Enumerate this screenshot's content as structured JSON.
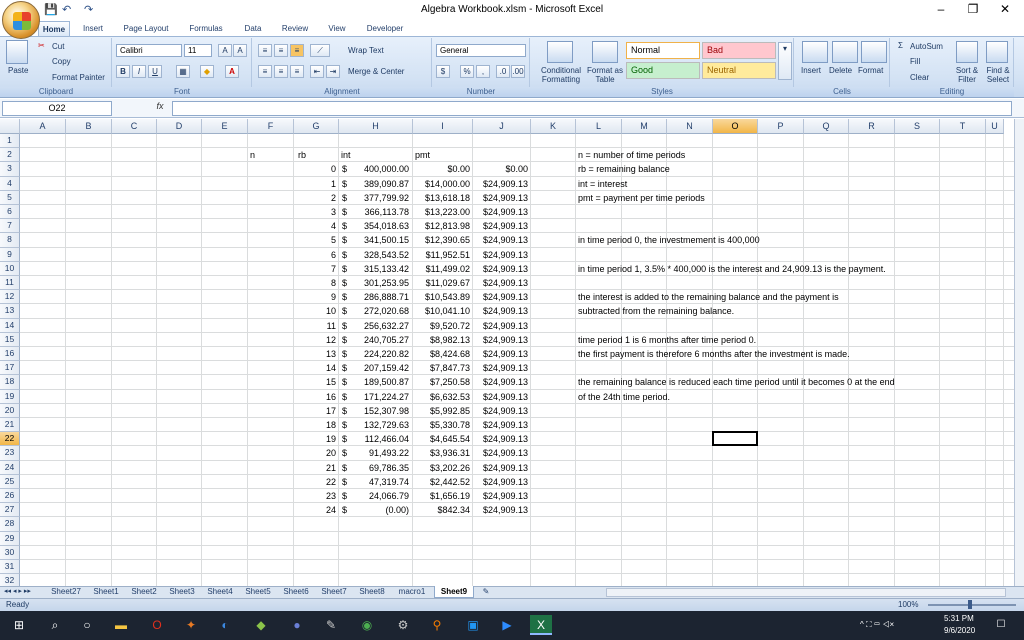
{
  "window": {
    "title": "Algebra Workbook.xlsm - Microsoft Excel",
    "controls": [
      "–",
      "❐",
      "✕"
    ]
  },
  "qat": {
    "save": "💾",
    "undo": "↶",
    "redo": "↷"
  },
  "tabs": [
    "Home",
    "Insert",
    "Page Layout",
    "Formulas",
    "Data",
    "Review",
    "View",
    "Developer"
  ],
  "ribbon": {
    "clipboard": {
      "paste": "Paste",
      "cut": "Cut",
      "copy": "Copy",
      "format_painter": "Format Painter",
      "label": "Clipboard"
    },
    "font": {
      "name": "Calibri",
      "size": "11",
      "bold": "B",
      "italic": "I",
      "underline": "U",
      "label": "Font"
    },
    "alignment": {
      "wrap": "Wrap Text",
      "merge": "Merge & Center",
      "label": "Alignment"
    },
    "number": {
      "format": "General",
      "currency": "$",
      "percent": "%",
      "comma": ",",
      "label": "Number"
    },
    "styles": {
      "cond": "Conditional Formatting",
      "table": "Format as Table",
      "normal": "Normal",
      "bad": "Bad",
      "good": "Good",
      "neutral": "Neutral",
      "label": "Styles"
    },
    "cells": {
      "insert": "Insert",
      "delete": "Delete",
      "format": "Format",
      "label": "Cells"
    },
    "editing": {
      "autosum": "AutoSum",
      "fill": "Fill",
      "clear": "Clear",
      "sort": "Sort & Filter",
      "find": "Find & Select",
      "label": "Editing"
    }
  },
  "formula_bar": {
    "name_box": "O22",
    "fx": "fx",
    "value": ""
  },
  "columns": [
    "A",
    "B",
    "C",
    "D",
    "E",
    "F",
    "G",
    "H",
    "I",
    "J",
    "K",
    "L",
    "M",
    "N",
    "O",
    "P",
    "Q",
    "R",
    "S",
    "T",
    "U"
  ],
  "selected_column": "O",
  "selected_row": 22,
  "rows": [
    "1",
    "2",
    "3",
    "4",
    "5",
    "6",
    "7",
    "8",
    "9",
    "10",
    "11",
    "12",
    "13",
    "14",
    "15",
    "16",
    "17",
    "18",
    "19",
    "20",
    "21",
    "22",
    "23",
    "24",
    "25",
    "26",
    "27",
    "28",
    "29",
    "30",
    "31",
    "32"
  ],
  "headers": {
    "n": "n",
    "rb": "rb",
    "int": "int",
    "pmt": "pmt"
  },
  "table": [
    {
      "n": "0",
      "rb": "400,000.00",
      "int": "$0.00",
      "pmt": "$0.00"
    },
    {
      "n": "1",
      "rb": "389,090.87",
      "int": "$14,000.00",
      "pmt": "$24,909.13"
    },
    {
      "n": "2",
      "rb": "377,799.92",
      "int": "$13,618.18",
      "pmt": "$24,909.13"
    },
    {
      "n": "3",
      "rb": "366,113.78",
      "int": "$13,223.00",
      "pmt": "$24,909.13"
    },
    {
      "n": "4",
      "rb": "354,018.63",
      "int": "$12,813.98",
      "pmt": "$24,909.13"
    },
    {
      "n": "5",
      "rb": "341,500.15",
      "int": "$12,390.65",
      "pmt": "$24,909.13"
    },
    {
      "n": "6",
      "rb": "328,543.52",
      "int": "$11,952.51",
      "pmt": "$24,909.13"
    },
    {
      "n": "7",
      "rb": "315,133.42",
      "int": "$11,499.02",
      "pmt": "$24,909.13"
    },
    {
      "n": "8",
      "rb": "301,253.95",
      "int": "$11,029.67",
      "pmt": "$24,909.13"
    },
    {
      "n": "9",
      "rb": "286,888.71",
      "int": "$10,543.89",
      "pmt": "$24,909.13"
    },
    {
      "n": "10",
      "rb": "272,020.68",
      "int": "$10,041.10",
      "pmt": "$24,909.13"
    },
    {
      "n": "11",
      "rb": "256,632.27",
      "int": "$9,520.72",
      "pmt": "$24,909.13"
    },
    {
      "n": "12",
      "rb": "240,705.27",
      "int": "$8,982.13",
      "pmt": "$24,909.13"
    },
    {
      "n": "13",
      "rb": "224,220.82",
      "int": "$8,424.68",
      "pmt": "$24,909.13"
    },
    {
      "n": "14",
      "rb": "207,159.42",
      "int": "$7,847.73",
      "pmt": "$24,909.13"
    },
    {
      "n": "15",
      "rb": "189,500.87",
      "int": "$7,250.58",
      "pmt": "$24,909.13"
    },
    {
      "n": "16",
      "rb": "171,224.27",
      "int": "$6,632.53",
      "pmt": "$24,909.13"
    },
    {
      "n": "17",
      "rb": "152,307.98",
      "int": "$5,992.85",
      "pmt": "$24,909.13"
    },
    {
      "n": "18",
      "rb": "132,729.63",
      "int": "$5,330.78",
      "pmt": "$24,909.13"
    },
    {
      "n": "19",
      "rb": "112,466.04",
      "int": "$4,645.54",
      "pmt": "$24,909.13"
    },
    {
      "n": "20",
      "rb": "91,493.22",
      "int": "$3,936.31",
      "pmt": "$24,909.13"
    },
    {
      "n": "21",
      "rb": "69,786.35",
      "int": "$3,202.26",
      "pmt": "$24,909.13"
    },
    {
      "n": "22",
      "rb": "47,319.74",
      "int": "$2,442.52",
      "pmt": "$24,909.13"
    },
    {
      "n": "23",
      "rb": "24,066.79",
      "int": "$1,656.19",
      "pmt": "$24,909.13"
    },
    {
      "n": "24",
      "rb": "(0.00)",
      "int": "$842.34",
      "pmt": "$24,909.13"
    }
  ],
  "currency_symbol": "$",
  "notes": [
    {
      "row": 2,
      "text": "n = number of time periods"
    },
    {
      "row": 3,
      "text": "rb = remaining balance"
    },
    {
      "row": 4,
      "text": "int = interest"
    },
    {
      "row": 5,
      "text": "pmt = payment per time periods"
    },
    {
      "row": 8,
      "text": "in time period 0, the investmement is 400,000"
    },
    {
      "row": 10,
      "text": "in time period 1, 3.5% * 400,000 is the interest and 24,909.13 is the payment."
    },
    {
      "row": 12,
      "text": "the interest is added to the remaining balance and the payment is"
    },
    {
      "row": 13,
      "text": "subtracted from the remaining balance."
    },
    {
      "row": 15,
      "text": "time period 1 is 6 months after time period 0."
    },
    {
      "row": 16,
      "text": "the first payment is therefore 6 months after the investment is made."
    },
    {
      "row": 18,
      "text": "the remaining balance is reduced each time period until it becomes 0 at the end"
    },
    {
      "row": 19,
      "text": "of the 24th time period."
    }
  ],
  "sheets": [
    "Sheet27",
    "Sheet1",
    "Sheet2",
    "Sheet3",
    "Sheet4",
    "Sheet5",
    "Sheet6",
    "Sheet7",
    "Sheet8",
    "macro1",
    "Sheet9"
  ],
  "active_sheet": "Sheet9",
  "status": {
    "ready": "Ready",
    "zoom": "100%"
  },
  "taskbar": {
    "time": "5:31 PM",
    "date": "9/6/2020"
  },
  "colors": {
    "accent": "#f2b648",
    "ribbon": "#d3e2f4",
    "bad": "#ffc7ce",
    "good": "#c6efce",
    "neutral": "#ffeb9c"
  }
}
